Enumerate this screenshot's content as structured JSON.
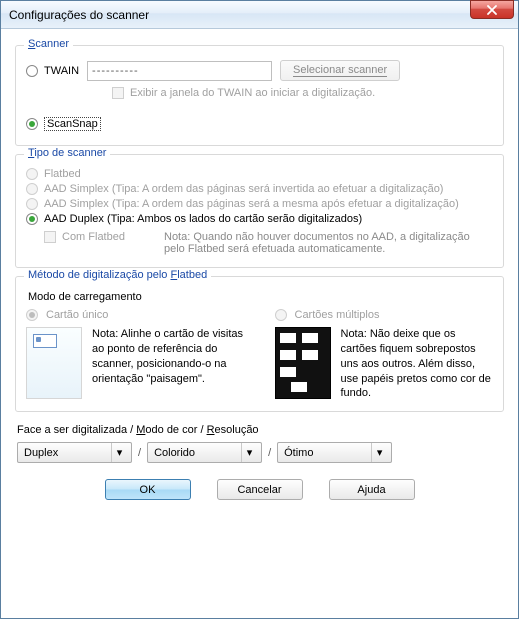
{
  "window": {
    "title": "Configurações do scanner"
  },
  "scanner": {
    "legend": "Scanner",
    "twain_label": "TWAIN",
    "twain_value": "----------",
    "select_btn": "Selecionar scanner",
    "show_window": "Exibir a janela do TWAIN ao iniciar a digitalização.",
    "scansnap_label": "ScanSnap"
  },
  "type": {
    "legend": "Tipo de scanner",
    "flatbed": "Flatbed",
    "aad_simplex_rev": "AAD Simplex (Tipa: A ordem das páginas será invertida ao efetuar a digitalização)",
    "aad_simplex_same": "AAD Simplex (Tipa: A ordem das páginas será a mesma após efetuar a digitalização)",
    "aad_duplex": "AAD Duplex (Tipa: Ambos os lados do cartão serão digitalizados)",
    "with_flatbed": "Com Flatbed",
    "note": "Nota: Quando não houver documentos no AAD, a digitalização pelo Flatbed será efetuada automaticamente."
  },
  "method": {
    "legend": "Método de digitalização pelo Flatbed",
    "loading": "Modo de carregamento",
    "single": "Cartão único",
    "multi": "Cartões múltiplos",
    "single_note": "Nota: Alinhe o cartão de visitas ao ponto de referência do scanner, posicionando-o na orientação \"paisagem\".",
    "multi_note": "Nota: Não deixe que os cartões fiquem sobrepostos uns aos outros. Além disso, use papéis pretos como cor de fundo."
  },
  "face": {
    "label": "Face a ser digitalizada / Modo de cor / Resolução",
    "duplex": "Duplex",
    "color": "Colorido",
    "res": "Ótimo"
  },
  "buttons": {
    "ok": "OK",
    "cancel": "Cancelar",
    "help": "Ajuda"
  }
}
